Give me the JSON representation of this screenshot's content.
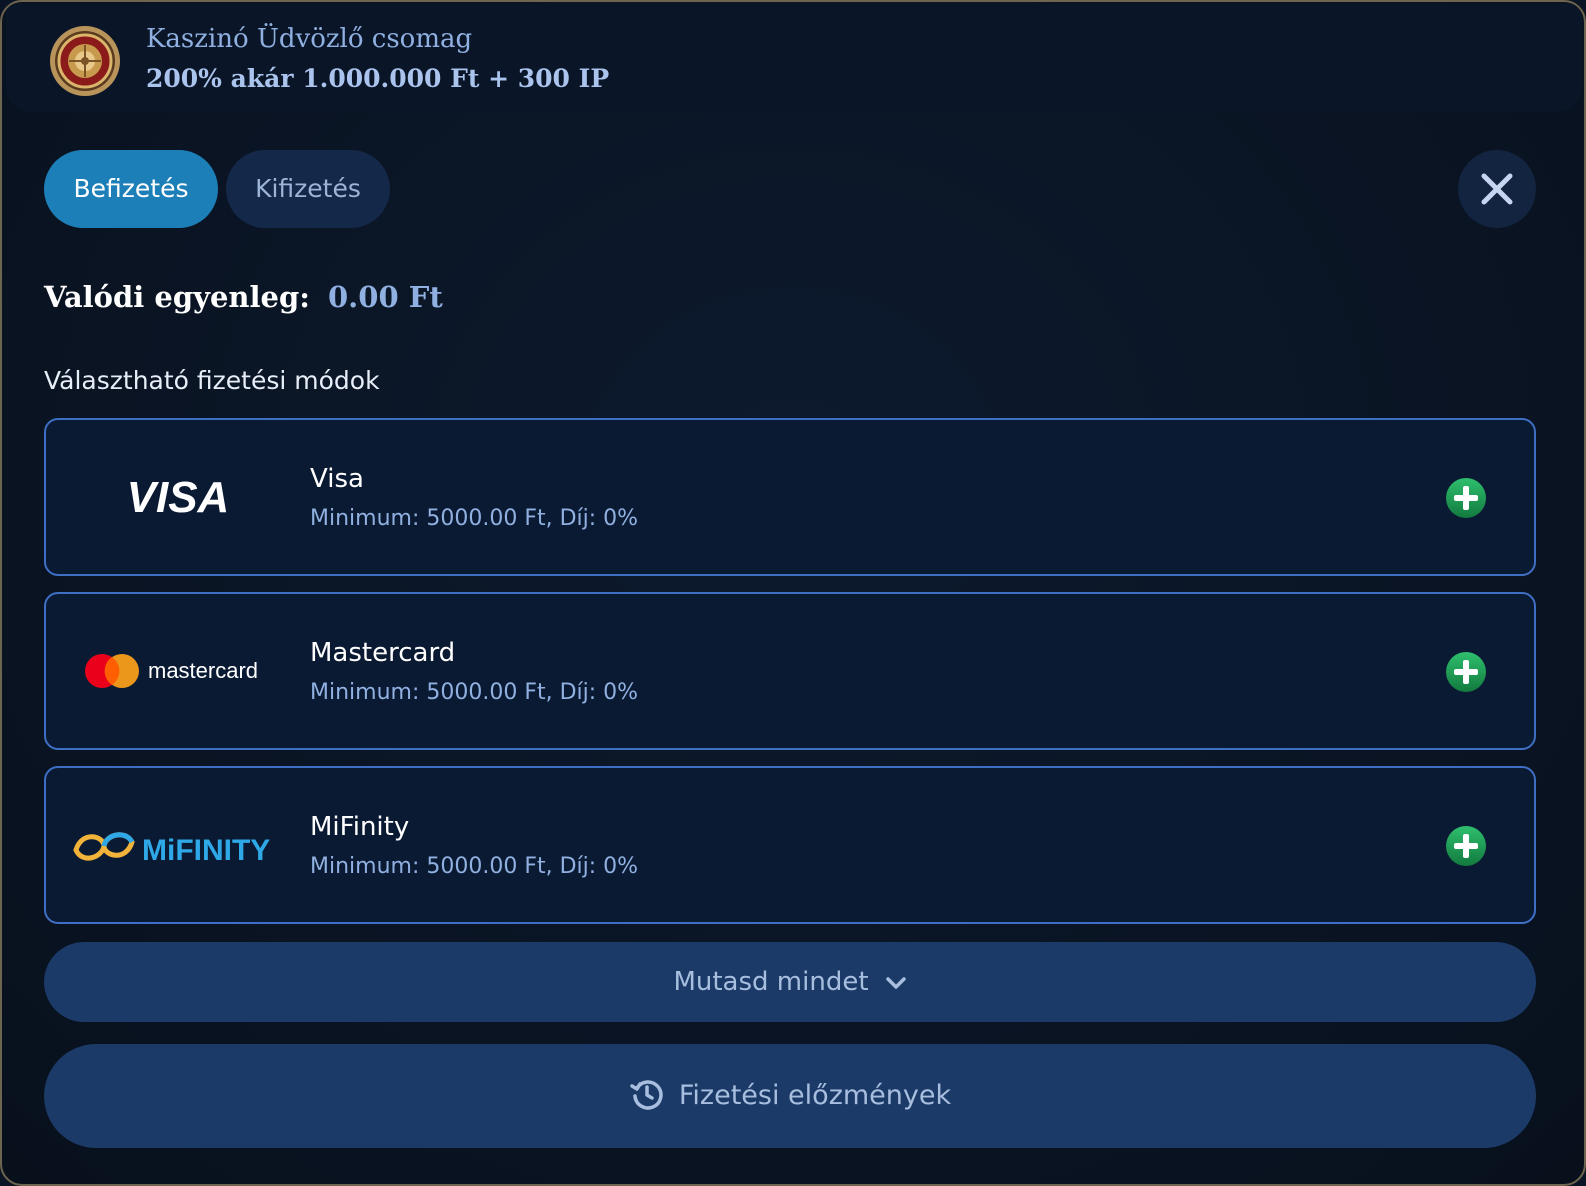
{
  "promo": {
    "icon": "roulette-icon",
    "title": "Kaszinó Üdvözlő csomag",
    "subtitle": "200% akár 1.000.000 Ft + 300 IP"
  },
  "tabs": [
    {
      "label": "Befizetés",
      "active": true
    },
    {
      "label": "Kifizetés",
      "active": false
    }
  ],
  "close": {
    "icon": "close-icon"
  },
  "balance": {
    "label": "Valódi egyenleg:",
    "value": "0.00 Ft"
  },
  "methods_title": "Választható fizetési módok",
  "methods": [
    {
      "logo": "visa-logo",
      "logo_text": "VISA",
      "name": "Visa",
      "desc": "Minimum: 5000.00 Ft, Díj: 0%"
    },
    {
      "logo": "mastercard-logo",
      "logo_text": "mastercard",
      "name": "Mastercard",
      "desc": "Minimum: 5000.00 Ft, Díj: 0%"
    },
    {
      "logo": "mifinity-logo",
      "logo_text": "MiFINITY",
      "name": "MiFinity",
      "desc": "Minimum: 5000.00 Ft, Díj: 0%"
    }
  ],
  "show_all": {
    "label": "Mutasd mindet",
    "icon": "chevron-down-icon"
  },
  "history": {
    "label": "Fizetési előzmények",
    "icon": "history-icon"
  },
  "colors": {
    "background": "#0b1424",
    "accent": "#1d7fb8",
    "card_border": "#3e6fc4",
    "button": "#1c3a68",
    "add": "#1f9e5a"
  }
}
